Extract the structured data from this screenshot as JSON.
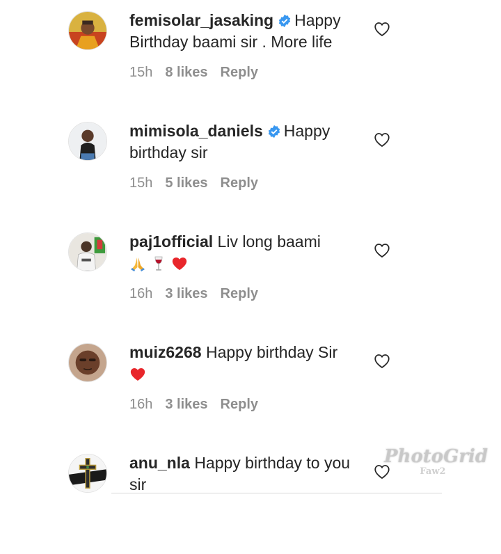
{
  "comments": [
    {
      "username": "femisolar_jasaking",
      "verified": true,
      "text": "Happy Birthday baami sir . More life",
      "time": "15h",
      "likes": "8 likes",
      "reply": "Reply",
      "emojis": []
    },
    {
      "username": "mimisola_daniels",
      "verified": true,
      "text": "Happy birthday sir",
      "time": "15h",
      "likes": "5 likes",
      "reply": "Reply",
      "emojis": []
    },
    {
      "username": "paj1official",
      "verified": false,
      "text": "Liv long baami",
      "time": "16h",
      "likes": "3 likes",
      "reply": "Reply",
      "emojis": [
        "folded-hands",
        "wine-glass",
        "red-heart"
      ]
    },
    {
      "username": "muiz6268",
      "verified": false,
      "text": "Happy birthday Sir",
      "time": "16h",
      "likes": "3 likes",
      "reply": "Reply",
      "emojis": [
        "red-heart"
      ]
    },
    {
      "username": "anu_nla",
      "verified": false,
      "text": "Happy birthday to you sir",
      "time": "",
      "likes": "",
      "reply": "",
      "emojis": []
    }
  ],
  "watermark": {
    "main": "PhotoGrid",
    "sub": "Faw2"
  },
  "icons": {
    "like": "heart-outline-icon",
    "verified": "verified-badge-icon"
  },
  "colors": {
    "verified": "#3897f0",
    "meta": "#8e8e8e",
    "heart": "#e8262b"
  }
}
